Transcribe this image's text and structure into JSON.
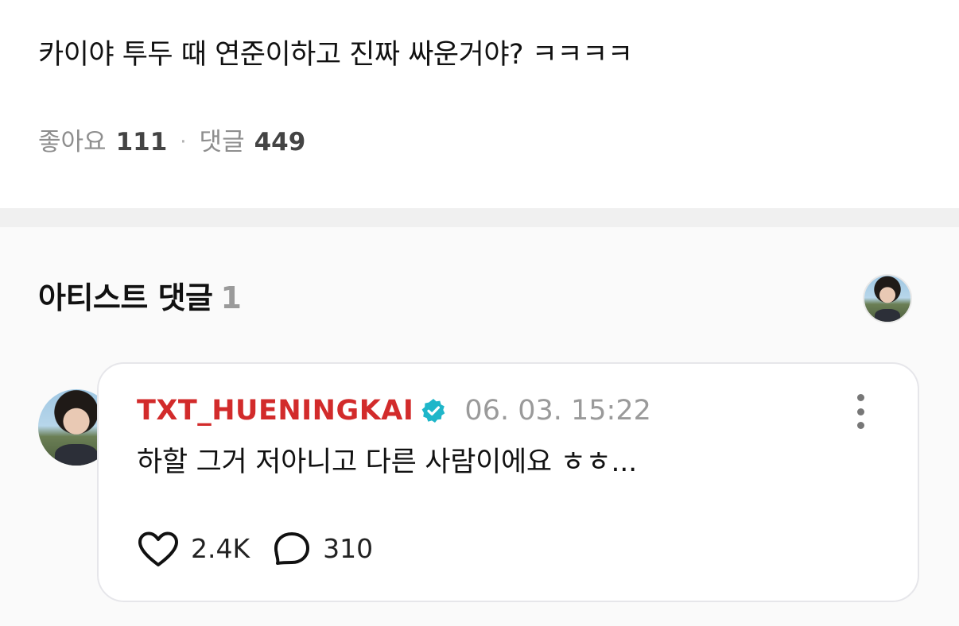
{
  "post": {
    "text": "카이야 투두 때 연준이하고 진짜 싸운거야? ㅋㅋㅋㅋ",
    "likes_label": "좋아요",
    "likes_count": "111",
    "separator": "·",
    "comments_label": "댓글",
    "comments_count": "449"
  },
  "artist_comments": {
    "title": "아티스트 댓글",
    "count": "1",
    "comment": {
      "author": "TXT_HUENINGKAI",
      "verified": true,
      "timestamp": "06. 03. 15:22",
      "text": "하할 그거 저아니고 다른 사람이에요  ㅎㅎ...",
      "likes": "2.4K",
      "replies": "310"
    }
  },
  "colors": {
    "author_name": "#d22b2b",
    "verified_badge": "#1fb6c9",
    "muted_text": "#8e8e8e",
    "section_bg": "#fafafa",
    "divider": "#f0f0f0"
  },
  "icons": {
    "verified": "verified-badge-icon",
    "more": "more-vertical-icon",
    "like": "heart-outline-icon",
    "reply": "speech-bubble-outline-icon"
  }
}
